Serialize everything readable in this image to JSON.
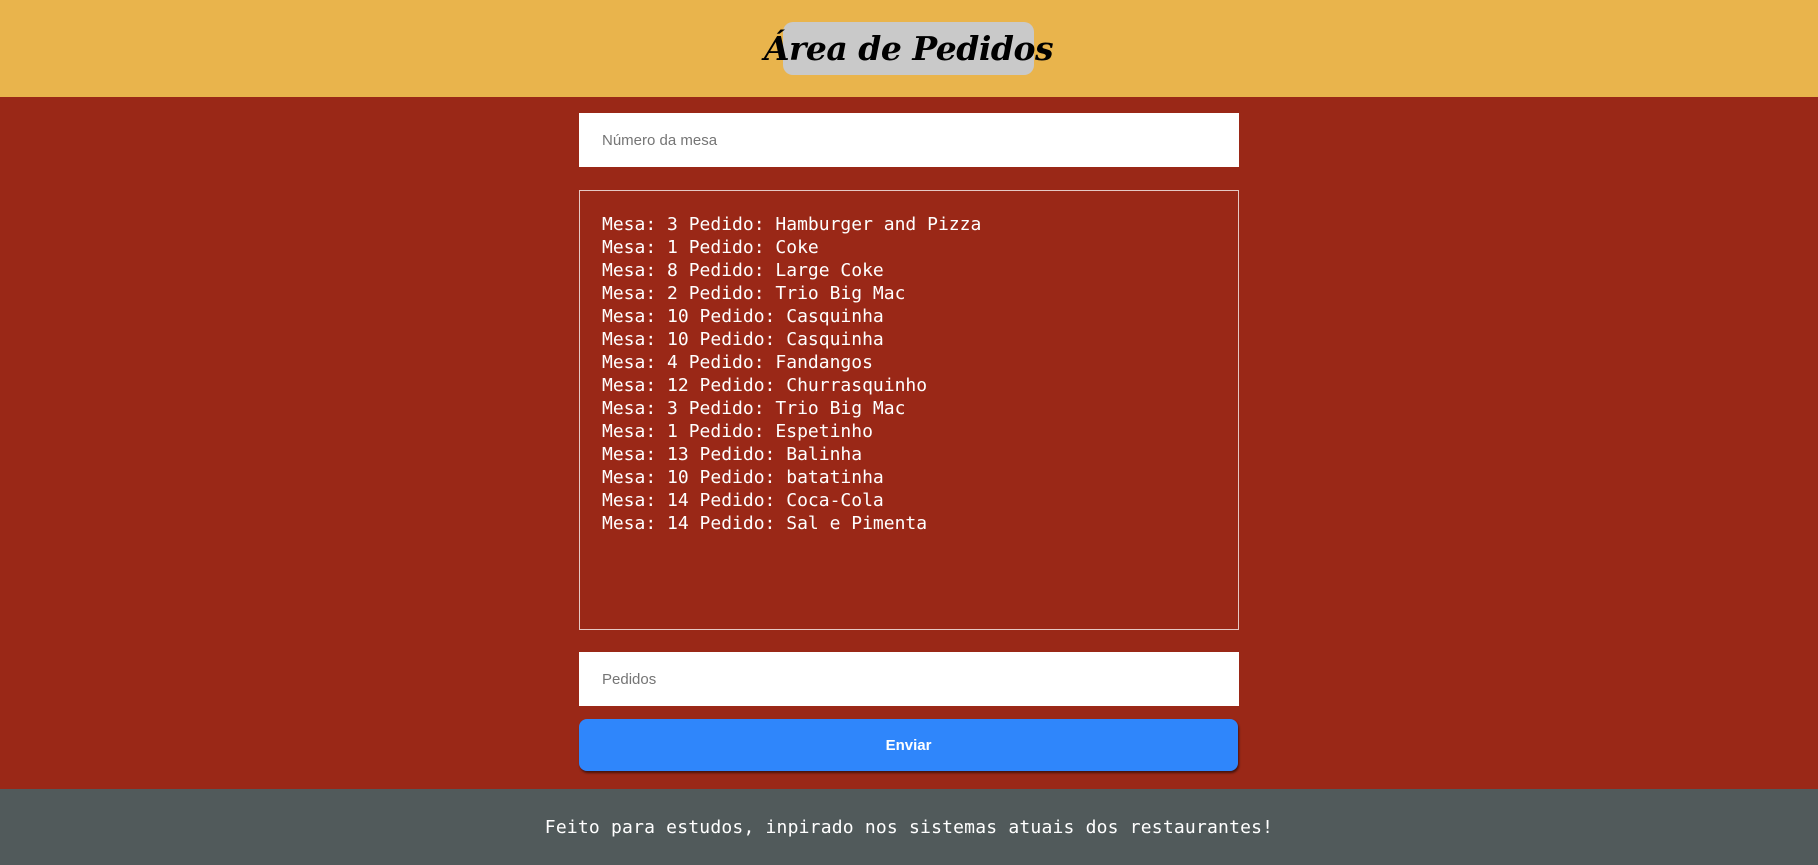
{
  "header": {
    "title": "Área de Pedidos",
    "background_color": "#e9b44c",
    "title_box_color": "#c9c9c9"
  },
  "form": {
    "table_number_placeholder": "Número da mesa",
    "table_number_value": "",
    "orders_placeholder": "Pedidos",
    "orders_value": "",
    "submit_label": "Enviar",
    "submit_color": "#2f86fb"
  },
  "orders_list": [
    "Mesa: 3 Pedido: Hamburger and Pizza",
    "Mesa: 1 Pedido: Coke",
    "Mesa: 8 Pedido: Large Coke",
    "Mesa: 2 Pedido: Trio Big Mac",
    "Mesa: 10 Pedido: Casquinha",
    "Mesa: 10 Pedido: Casquinha",
    "Mesa: 4 Pedido: Fandangos",
    "Mesa: 12 Pedido: Churrasquinho",
    "Mesa: 3 Pedido: Trio Big Mac",
    "Mesa: 1 Pedido: Espetinho",
    "Mesa: 13 Pedido: Balinha",
    "Mesa: 10 Pedido: batatinha",
    "Mesa: 14 Pedido: Coca-Cola",
    "Mesa: 14 Pedido: Sal e Pimenta"
  ],
  "main": {
    "background_color": "#9a2817"
  },
  "footer": {
    "text": "Feito para estudos, inpirado nos sistemas atuais dos restaurantes!",
    "background_color": "#515a5b"
  }
}
